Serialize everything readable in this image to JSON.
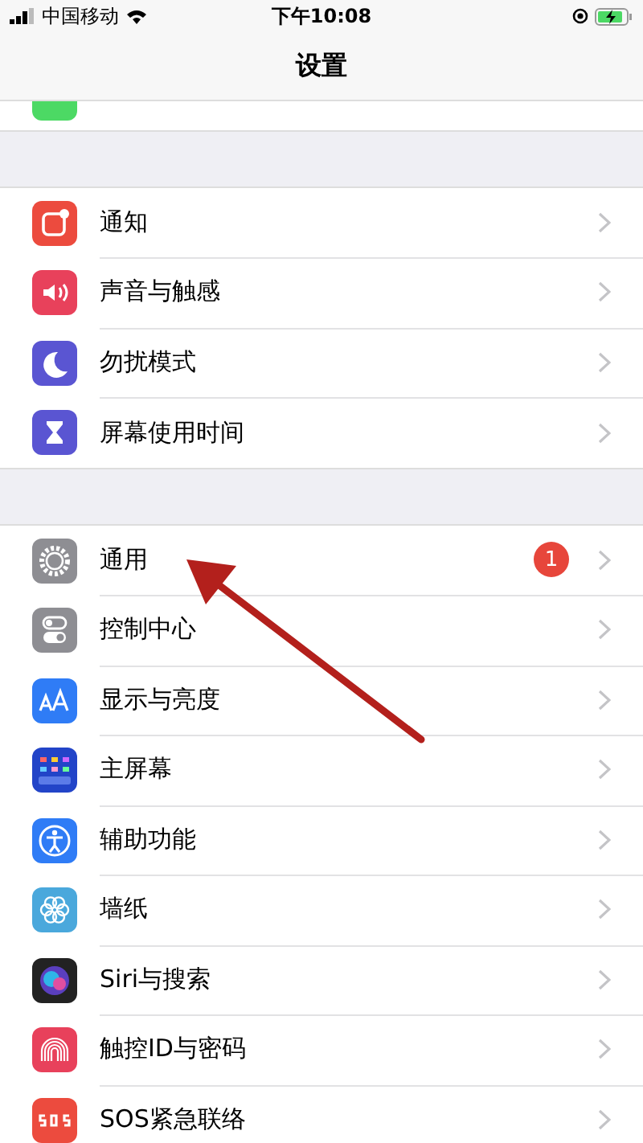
{
  "status_bar": {
    "carrier": "中国移动",
    "time": "下午10:08"
  },
  "nav": {
    "title": "设置"
  },
  "groups": [
    {
      "rows": [
        {
          "label": "通知"
        },
        {
          "label": "声音与触感"
        },
        {
          "label": "勿扰模式"
        },
        {
          "label": "屏幕使用时间"
        }
      ]
    },
    {
      "rows": [
        {
          "label": "通用",
          "badge": "1"
        },
        {
          "label": "控制中心"
        },
        {
          "label": "显示与亮度"
        },
        {
          "label": "主屏幕"
        },
        {
          "label": "辅助功能"
        },
        {
          "label": "墙纸"
        },
        {
          "label": "Siri与搜索"
        },
        {
          "label": "触控ID与密码"
        },
        {
          "label": "SOS紧急联络"
        }
      ]
    }
  ]
}
